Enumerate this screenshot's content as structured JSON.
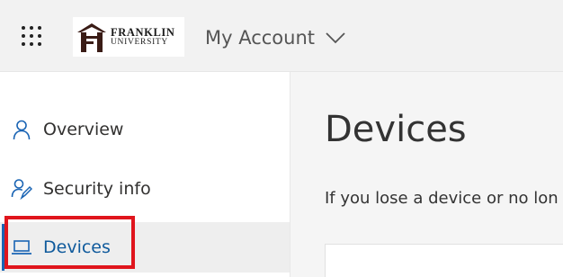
{
  "header": {
    "logo": {
      "line1": "FRANKLIN",
      "line2": "UNIVERSITY"
    },
    "account_label": "My Account"
  },
  "sidebar": {
    "items": [
      {
        "label": "Overview",
        "icon": "person-icon",
        "active": false
      },
      {
        "label": "Security info",
        "icon": "person-key-icon",
        "active": false
      },
      {
        "label": "Devices",
        "icon": "laptop-icon",
        "active": true
      }
    ]
  },
  "main": {
    "title": "Devices",
    "intro": "If you lose a device or no lon"
  },
  "colors": {
    "accent": "#1a64b4",
    "highlight_box": "#e0151d",
    "active_text": "#0f5a9c"
  }
}
